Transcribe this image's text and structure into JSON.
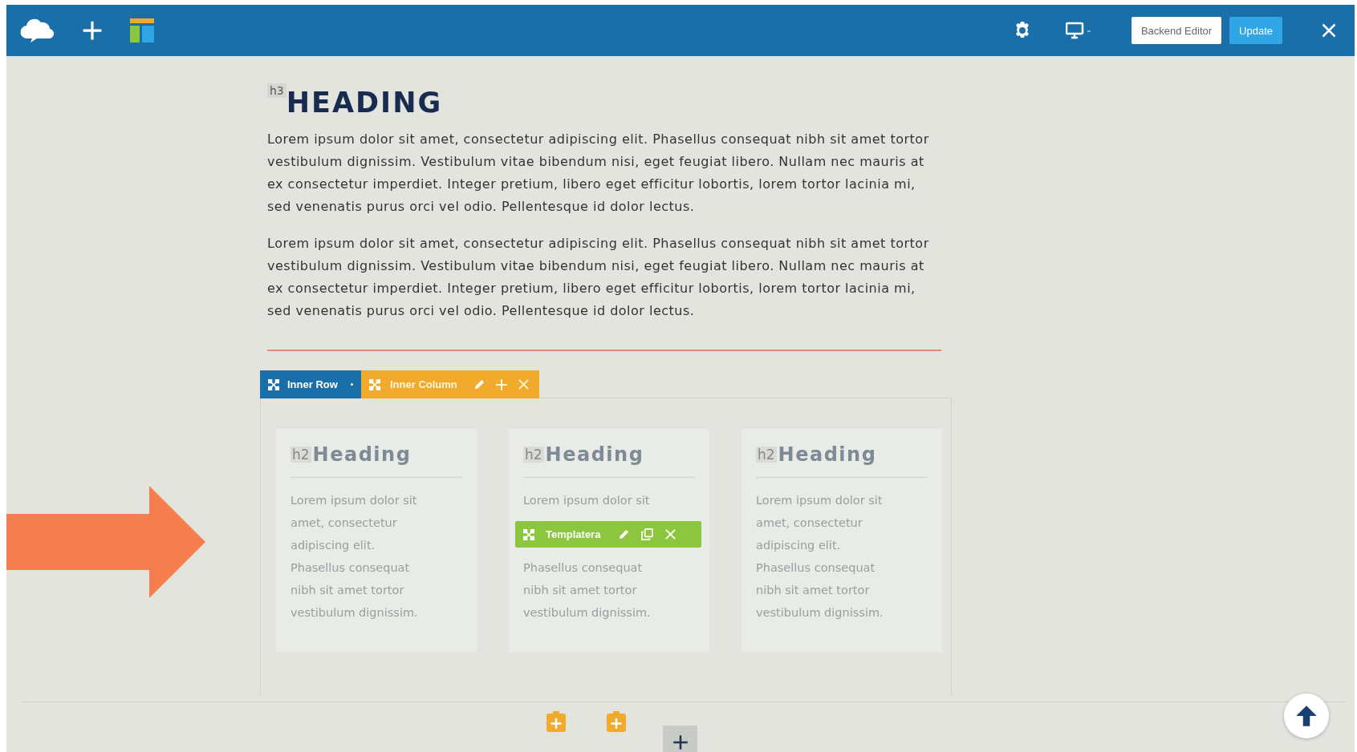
{
  "top_bar": {
    "buttons": [
      {
        "label": "Backend Editor",
        "kind": "secondary"
      },
      {
        "label": "Update",
        "kind": "primary"
      }
    ]
  },
  "heading": {
    "tag": "h3",
    "text": "HEADING"
  },
  "paragraphs": [
    "Lorem ipsum dolor sit amet, consectetur adipiscing elit. Phasellus consequat nibh sit amet tortor vestibulum dignissim. Vestibulum vitae bibendum nisi, eget feugiat libero. Nullam nec mauris at ex consectetur imperdiet. Integer pretium, libero eget efficitur lobortis, lorem tortor lacinia mi, sed venenatis purus orci vel odio. Pellentesque id dolor lectus.",
    "Lorem ipsum dolor sit amet, consectetur adipiscing elit. Phasellus consequat nibh sit amet tortor vestibulum dignissim. Vestibulum vitae bibendum nisi, eget feugiat libero. Nullam nec mauris at ex consectetur imperdiet. Integer pretium, libero eget efficitur lobortis, lorem tortor lacinia mi, sed venenatis purus orci vel odio. Pellentesque id dolor lectus."
  ],
  "row_toolbar": {
    "row_label": "Inner Row",
    "column_label": "Inner Column"
  },
  "cards": [
    {
      "tag": "h2",
      "heading": "Heading",
      "lines": [
        "Lorem ipsum dolor sit",
        "amet, consectetur",
        "adipiscing elit.",
        "Phasellus consequat",
        "nibh sit amet tortor",
        "vestibulum dignissim."
      ]
    },
    {
      "tag": "h2",
      "heading": "Heading",
      "lines": [
        "Lorem ipsum dolor sit"
      ],
      "element_toolbar": {
        "label": "Templatera"
      },
      "lines_after": [
        "Phasellus consequat",
        "nibh sit amet tortor",
        "vestibulum dignissim."
      ]
    },
    {
      "tag": "h2",
      "heading": "Heading",
      "lines": [
        "Lorem ipsum dolor sit",
        "amet, consectetur",
        "adipiscing elit.",
        "Phasellus consequat",
        "nibh sit amet tortor",
        "vestibulum dignissim."
      ]
    }
  ]
}
